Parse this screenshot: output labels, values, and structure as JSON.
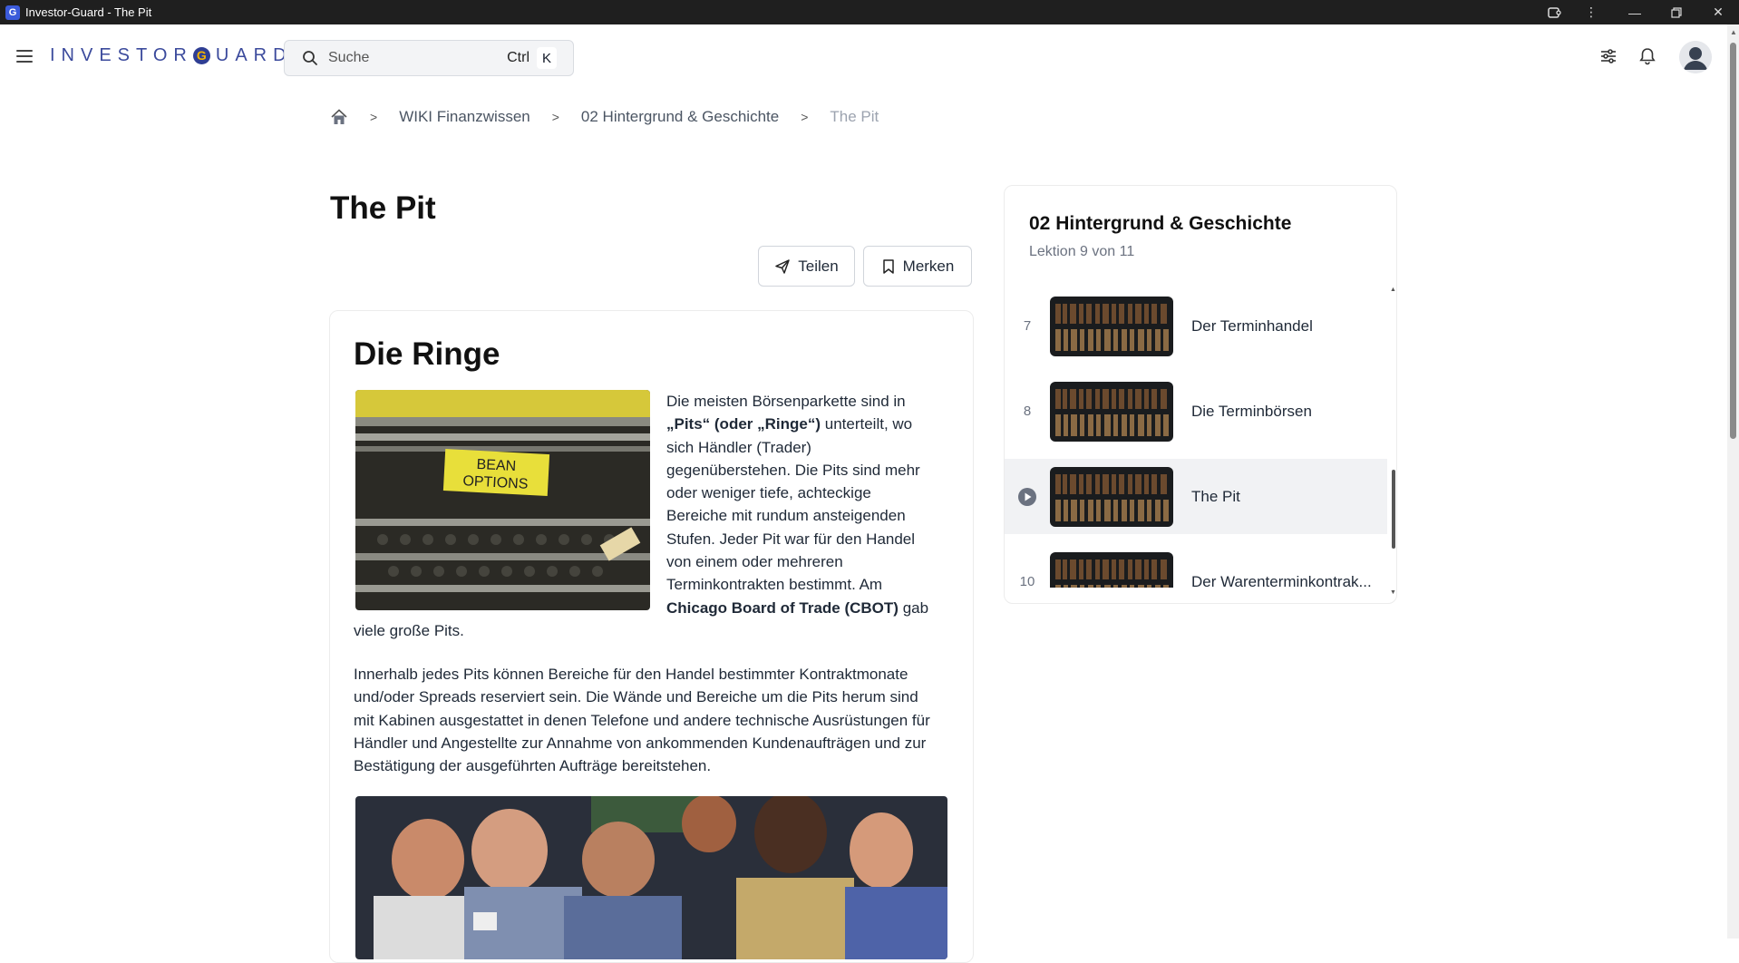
{
  "window": {
    "title": "Investor-Guard - The Pit"
  },
  "header": {
    "logo_left": "INVESTOR",
    "logo_g": "G",
    "logo_right": "UARD",
    "search_placeholder": "Suche",
    "search_shortcut_mod": "Ctrl",
    "search_shortcut_key": "K"
  },
  "breadcrumb": {
    "items": [
      "WIKI Finanzwissen",
      "02 Hintergrund & Geschichte"
    ],
    "current": "The Pit"
  },
  "page": {
    "title": "The Pit",
    "share_label": "Teilen",
    "bookmark_label": "Merken"
  },
  "article": {
    "heading": "Die Ringe",
    "image1_sign": "BEAN OPTIONS",
    "p1_a": "Die meisten Börsenparkette sind in ",
    "p1_b": "„Pits“ (oder „Ringe“)",
    "p1_c": " unterteilt, wo sich Händler (Trader) gegenüberstehen. Die Pits sind mehr oder weniger tiefe, achteckige Bereiche mit rundum ansteigenden Stufen. Jeder Pit war für den Handel von einem oder mehreren Terminkontrakten bestimmt. Am ",
    "p1_d": "Chicago Board of Trade (CBOT)",
    "p1_e": " gab viele große Pits.",
    "p2": "Innerhalb jedes Pits können Bereiche für den Handel bestimmter Kontraktmonate und/oder Spreads reserviert sein. Die Wände und Bereiche um die Pits herum sind mit Kabinen ausgestattet in denen Telefone und andere technische Ausrüstungen für Händler und Angestellte zur Annahme von ankommenden Kundenaufträgen und zur Bestätigung der ausgeführten Aufträge bereitstehen."
  },
  "sidebar": {
    "title": "02 Hintergrund & Geschichte",
    "subtitle": "Lektion 9 von 11",
    "lessons": [
      {
        "num": "7",
        "name": "Der Terminhandel"
      },
      {
        "num": "8",
        "name": "Die Terminbörsen"
      },
      {
        "num": "",
        "name": "The Pit"
      },
      {
        "num": "10",
        "name": "Der Warenterminkontrak..."
      }
    ]
  },
  "colors": {
    "brand": "#3b4a9c",
    "accent_gold": "#f4b400",
    "active_row": "#f1f2f4"
  }
}
